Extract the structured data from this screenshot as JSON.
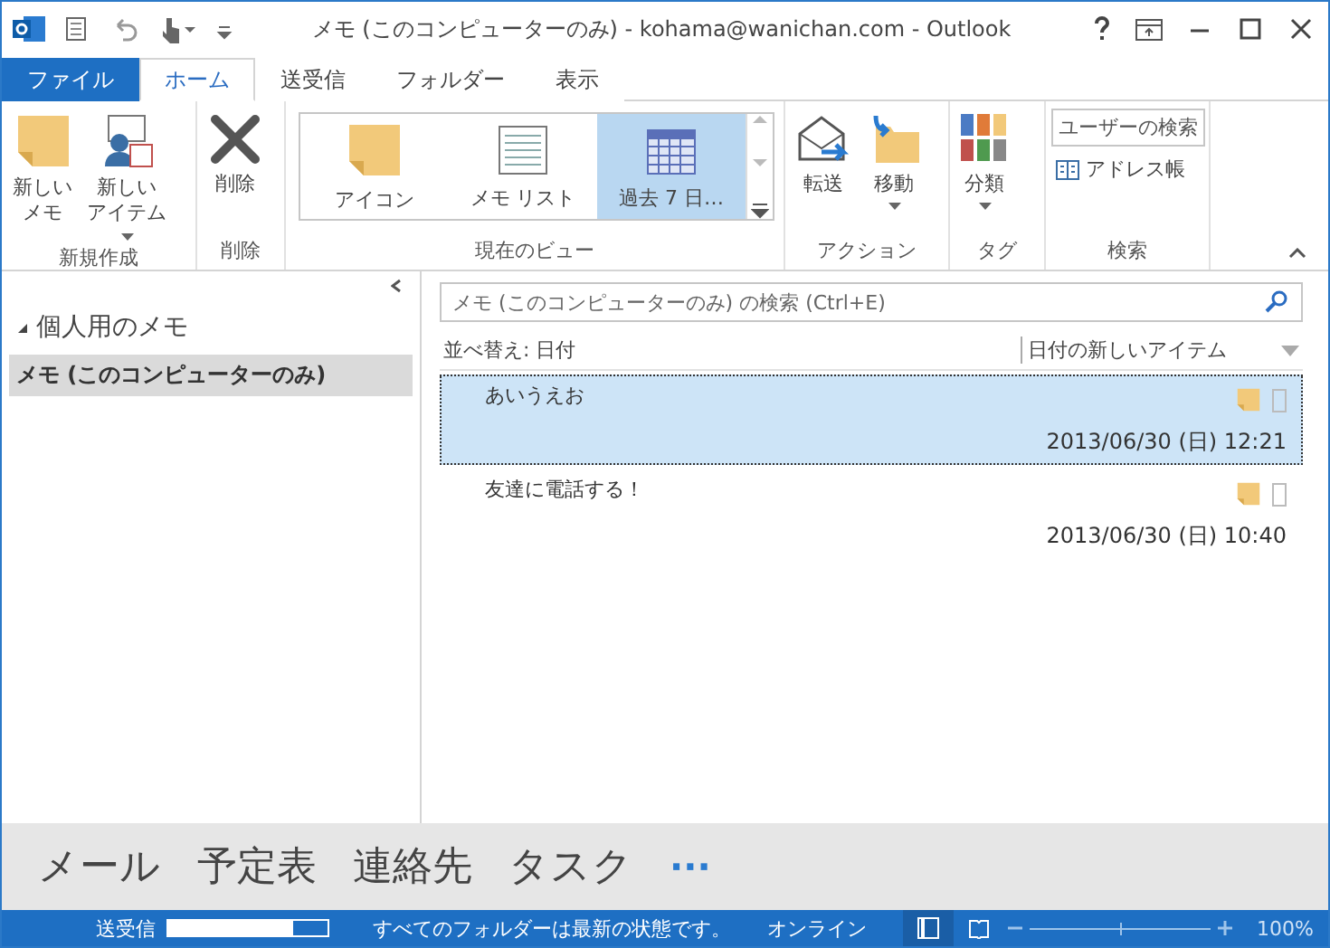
{
  "window": {
    "title": "メモ (このコンピューターのみ) - kohama@wanichan.com - Outlook"
  },
  "tabs": [
    {
      "label": "ファイル",
      "kind": "file",
      "selected": false
    },
    {
      "label": "ホーム",
      "kind": "tab",
      "selected": true
    },
    {
      "label": "送受信",
      "kind": "tab",
      "selected": false
    },
    {
      "label": "フォルダー",
      "kind": "tab",
      "selected": false
    },
    {
      "label": "表示",
      "kind": "tab",
      "selected": false
    }
  ],
  "ribbon": [
    {
      "label": "新規作成",
      "kind": "buttons",
      "items": [
        {
          "lines": [
            "新しい",
            "メモ"
          ],
          "dropdown": false
        },
        {
          "lines": [
            "新しい",
            "アイテム"
          ],
          "dropdown": true
        }
      ]
    },
    {
      "label": "削除",
      "kind": "buttons",
      "items": [
        {
          "lines": [
            "削除"
          ],
          "dropdown": false
        }
      ]
    },
    {
      "label": "現在のビュー",
      "kind": "gallery",
      "items": [
        {
          "label": "アイコン",
          "selected": false
        },
        {
          "label": "メモ リスト",
          "selected": false
        },
        {
          "label": "過去 7 日…",
          "selected": true
        }
      ]
    },
    {
      "label": "アクション",
      "kind": "buttons",
      "items": [
        {
          "lines": [
            "転送"
          ],
          "dropdown": false
        },
        {
          "lines": [
            "移動"
          ],
          "dropdown": true
        }
      ]
    },
    {
      "label": "タグ",
      "kind": "buttons",
      "items": [
        {
          "lines": [
            "分類"
          ],
          "dropdown": true
        }
      ]
    },
    {
      "label": "検索",
      "kind": "search",
      "items": [
        {
          "label": "ユーザーの検索",
          "kind": "field"
        },
        {
          "label": "アドレス帳",
          "kind": "button"
        }
      ]
    }
  ],
  "sidebar": {
    "title": "個人用のメモ",
    "expanded": true,
    "items": [
      {
        "label": "メモ (このコンピューターのみ)",
        "selected": true
      }
    ]
  },
  "search": {
    "placeholder": "メモ (このコンピューターのみ) の検索 (Ctrl+E)"
  },
  "sort": {
    "label": "並べ替え: 日付",
    "order": "日付の新しいアイテム"
  },
  "notes": [
    {
      "title": "あいうえお",
      "date": "2013/06/30 (日) 12:21",
      "selected": true
    },
    {
      "title": "友達に電話する！",
      "date": "2013/06/30 (日) 10:40",
      "selected": false
    }
  ],
  "navigation": {
    "items": [
      "メール",
      "予定表",
      "連絡先",
      "タスク"
    ],
    "more": "···"
  },
  "status_bar": {
    "sync_label": "送受信",
    "level": 0.78,
    "message": "すべてのフォルダーは最新の状態です。",
    "connection": "オンライン",
    "zoom": "100%",
    "zoom_slider": {
      "level": 0.5
    }
  }
}
